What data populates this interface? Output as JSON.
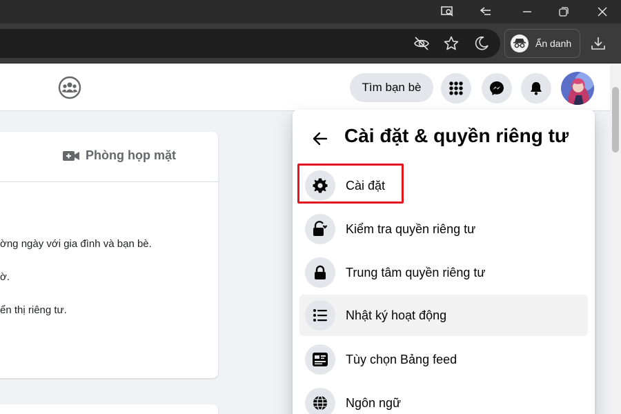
{
  "browser": {
    "incognito_label": "Ẩn danh",
    "window_buttons": [
      "screenshot-search-icon",
      "tab-actions-icon",
      "minimize-icon",
      "restore-icon",
      "close-icon"
    ],
    "toolbar_icons": [
      "tracking-prevention-icon",
      "favorite-star-icon",
      "dark-mode-icon",
      "download-icon"
    ]
  },
  "header": {
    "find_friends_label": "Tìm bạn bè",
    "buttons": [
      "menu-grid-icon",
      "messenger-icon",
      "notifications-bell-icon"
    ]
  },
  "card": {
    "tab_label": "Phòng họp mặt",
    "lines": [
      "ờng ngày với gia đình và bạn bè.",
      "ờ.",
      "ển thị riêng tư."
    ]
  },
  "panel": {
    "title": "Cài đặt & quyền riêng tư",
    "items": [
      {
        "label": "Cài đặt",
        "icon": "gear-icon"
      },
      {
        "label": "Kiểm tra quyền riêng tư",
        "icon": "lock-heart-icon"
      },
      {
        "label": "Trung tâm quyền riêng tư",
        "icon": "lock-icon"
      },
      {
        "label": "Nhật ký hoạt động",
        "icon": "list-icon"
      },
      {
        "label": "Tùy chọn Bảng feed",
        "icon": "feed-icon"
      },
      {
        "label": "Ngôn ngữ",
        "icon": "globe-icon"
      }
    ]
  },
  "colors": {
    "highlight_border": "#e4151f",
    "button_bg": "#e4e6eb"
  }
}
